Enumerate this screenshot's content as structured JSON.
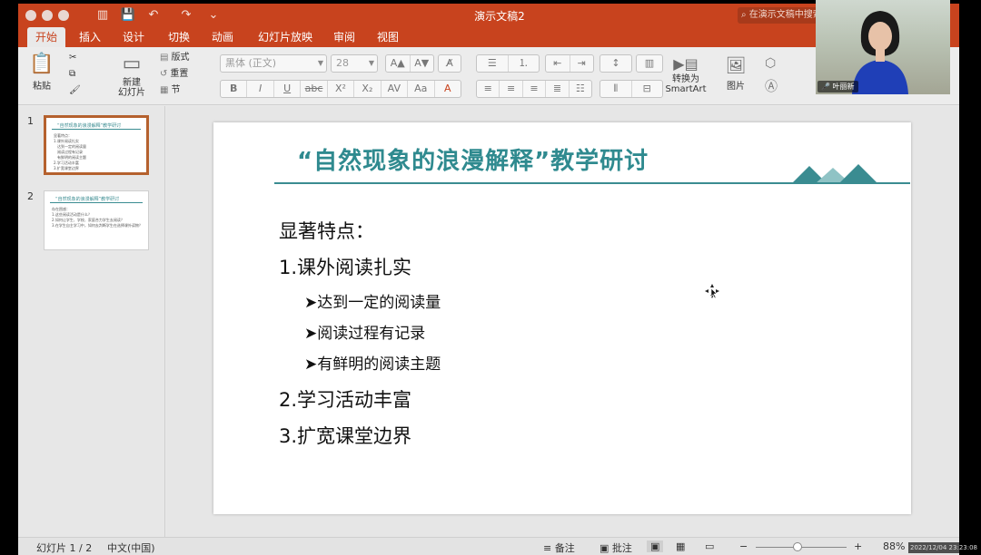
{
  "app": {
    "doc_title": "演示文稿2",
    "search_placeholder": "在演示文稿中搜索"
  },
  "tabs": [
    "开始",
    "插入",
    "设计",
    "切换",
    "动画",
    "幻灯片放映",
    "审阅",
    "视图"
  ],
  "ribbon": {
    "paste": "粘贴",
    "new_slide": "新建\n幻灯片",
    "layout": "版式",
    "reset": "重置",
    "section": "节",
    "font_name": "黑体 (正文)",
    "font_size": "28",
    "convert_smartart": "转换为\nSmartArt",
    "picture": "图片"
  },
  "thumbnails": [
    {
      "num": "1",
      "title": "“自然现象的浪漫解释”教学研讨",
      "lines": [
        "显著特点：",
        "1.课外阅读扎实",
        "  达到一定的阅读量",
        "  阅读过程有记录",
        "  有鲜明的阅读主题",
        "2.学习活动丰富",
        "3.扩宽课堂边界"
      ]
    },
    {
      "num": "2",
      "title": "“自然现象的浪漫解释”教学研讨",
      "lines": [
        "存在困惑：",
        "1.这些阅读活动是什么？",
        "2.如何让学生、学校、家庭合力学生去阅读？",
        "3.在学生自主学习中，如何去判断学生在选择课外读物？"
      ]
    }
  ],
  "slide": {
    "title": "“自然现象的浪漫解释”教学研讨",
    "heading": "显著特点：",
    "items": [
      {
        "text": "1.课外阅读扎实",
        "sub": [
          "➤达到一定的阅读量",
          "➤阅读过程有记录",
          "➤有鲜明的阅读主题"
        ]
      },
      {
        "text": "2.学习活动丰富",
        "sub": []
      },
      {
        "text": "3.扩宽课堂边界",
        "sub": []
      }
    ]
  },
  "statusbar": {
    "slide_counter": "幻灯片 1 / 2",
    "language": "中文(中国)",
    "notes": "备注",
    "comments": "批注",
    "zoom": "88%"
  },
  "video": {
    "participant_name": "叶丽新",
    "timestamp": "2022/12/04 23:23:08"
  },
  "colors": {
    "accent": "#c8431e",
    "slide_teal": "#2f8a8f"
  }
}
